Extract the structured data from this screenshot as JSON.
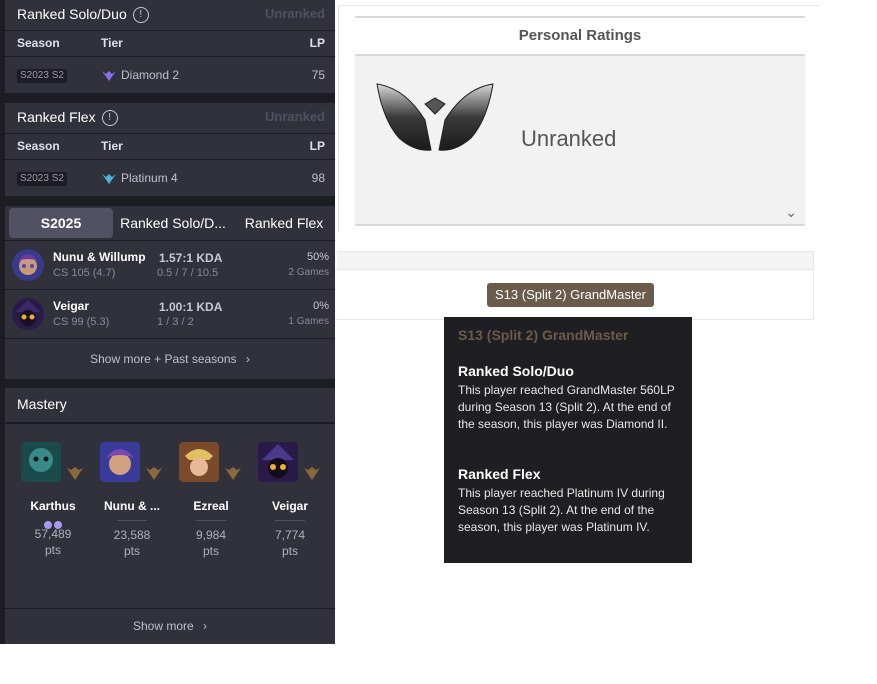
{
  "solo": {
    "title": "Ranked Solo/Duo",
    "status": "Unranked",
    "headers": {
      "season": "Season",
      "tier": "Tier",
      "lp": "LP"
    },
    "row": {
      "season": "S2023 S2",
      "tier": "Diamond 2",
      "lp": "75"
    }
  },
  "flex": {
    "title": "Ranked Flex",
    "status": "Unranked",
    "headers": {
      "season": "Season",
      "tier": "Tier",
      "lp": "LP"
    },
    "row": {
      "season": "S2023 S2",
      "tier": "Platinum 4",
      "lp": "98"
    }
  },
  "tabs": {
    "active": "S2025",
    "solo": "Ranked Solo/D...",
    "flex": "Ranked Flex"
  },
  "champions": [
    {
      "name": "Nunu & Willump",
      "cs": "CS 105 (4.7)",
      "kda": "1.57:1 KDA",
      "kda_detail": "0.5 / 7 / 10.5",
      "winrate": "50%",
      "games": "2 Games"
    },
    {
      "name": "Veigar",
      "cs": "CS 99 (5.3)",
      "kda": "1.00:1 KDA",
      "kda_detail": "1 / 3 / 2",
      "winrate": "0%",
      "games": "1 Games"
    }
  ],
  "show_more_seasons": "Show more + Past seasons",
  "mastery": {
    "title": "Mastery",
    "show_more": "Show more",
    "unit": "pts",
    "champions": [
      {
        "name": "Karthus",
        "points": "57,489"
      },
      {
        "name": "Nunu & ...",
        "points": "23,588"
      },
      {
        "name": "Ezreal",
        "points": "9,984"
      },
      {
        "name": "Veigar",
        "points": "7,774"
      }
    ]
  },
  "personal_ratings": {
    "title": "Personal Ratings",
    "rank": "Unranked",
    "chevron": "⌄"
  },
  "history_badge": "S13 (Split 2) GrandMaster",
  "tooltip": {
    "title": "S13 (Split 2) GrandMaster",
    "solo_title": "Ranked Solo/Duo",
    "solo_text": "This player reached GrandMaster 560LP during Season 13 (Split 2). At the end of the season, this player was Diamond II.",
    "flex_title": "Ranked Flex",
    "flex_text": "This player reached Platinum IV during Season 13 (Split 2). At the end of the season, this player was Platinum IV."
  },
  "colors": {
    "panel": "#31313c",
    "bg": "#1c1c22",
    "badge": "#6b5b4b",
    "accent_diamond": "#8f6bf0",
    "accent_platinum": "#4fb3d9"
  }
}
